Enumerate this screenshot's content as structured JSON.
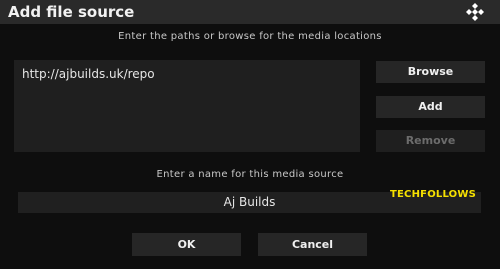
{
  "dialog": {
    "title": "Add file source",
    "paths_caption": "Enter the paths or browse for the media locations",
    "paths": [
      "http://ajbuilds.uk/repo"
    ],
    "buttons": {
      "browse": "Browse",
      "add": "Add",
      "remove": "Remove"
    },
    "name_caption": "Enter a name for this media source",
    "name_value": "Aj Builds",
    "ok": "OK",
    "cancel": "Cancel"
  },
  "watermark": "TECHFOLLOWS",
  "icons": {
    "logo": "kodi-logo-icon"
  },
  "colors": {
    "watermark": "#f5e000",
    "disabled_text": "#6c6c6c"
  }
}
